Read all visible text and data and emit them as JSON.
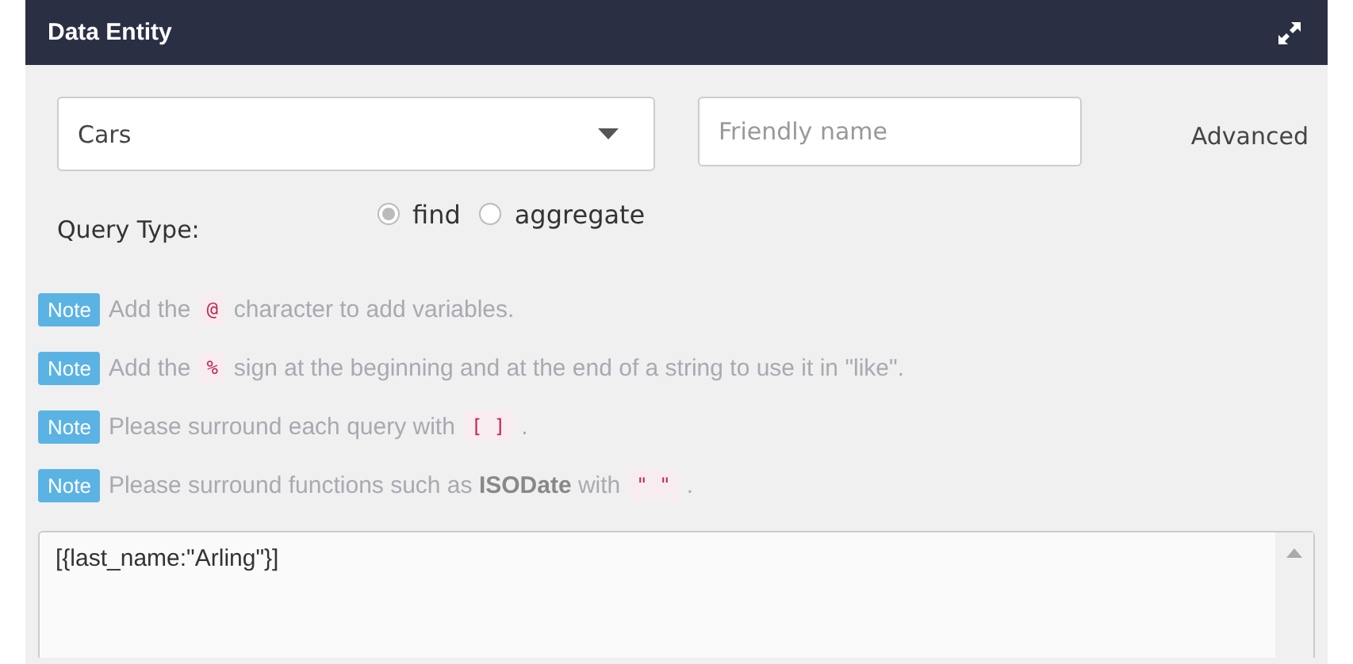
{
  "panel": {
    "title": "Data Entity"
  },
  "entity_select": {
    "value": "Cars"
  },
  "friendly_name": {
    "placeholder": "Friendly name"
  },
  "advanced_link": "Advanced",
  "query_type": {
    "label": "Query Type:",
    "options": [
      {
        "label": "find",
        "selected": true
      },
      {
        "label": "aggregate",
        "selected": false
      }
    ]
  },
  "notes": [
    {
      "badge": "Note",
      "parts": [
        {
          "kind": "text",
          "text": "Add the"
        },
        {
          "kind": "code",
          "text": "@"
        },
        {
          "kind": "text",
          "text": "character to add variables."
        }
      ]
    },
    {
      "badge": "Note",
      "parts": [
        {
          "kind": "text",
          "text": "Add the"
        },
        {
          "kind": "code",
          "text": "%"
        },
        {
          "kind": "text",
          "text": "sign at the beginning and at the end of a string to use it in \"like\"."
        }
      ]
    },
    {
      "badge": "Note",
      "parts": [
        {
          "kind": "text",
          "text": "Please surround each query with"
        },
        {
          "kind": "code",
          "text": "[ ]"
        },
        {
          "kind": "text",
          "text": "."
        }
      ]
    },
    {
      "badge": "Note",
      "parts": [
        {
          "kind": "text",
          "text": "Please surround functions such as **ISODate** with"
        },
        {
          "kind": "code",
          "text": "\" \""
        },
        {
          "kind": "text",
          "text": "."
        }
      ]
    }
  ],
  "query_editor": {
    "value": "[{last_name:\"Arling\"}]"
  }
}
